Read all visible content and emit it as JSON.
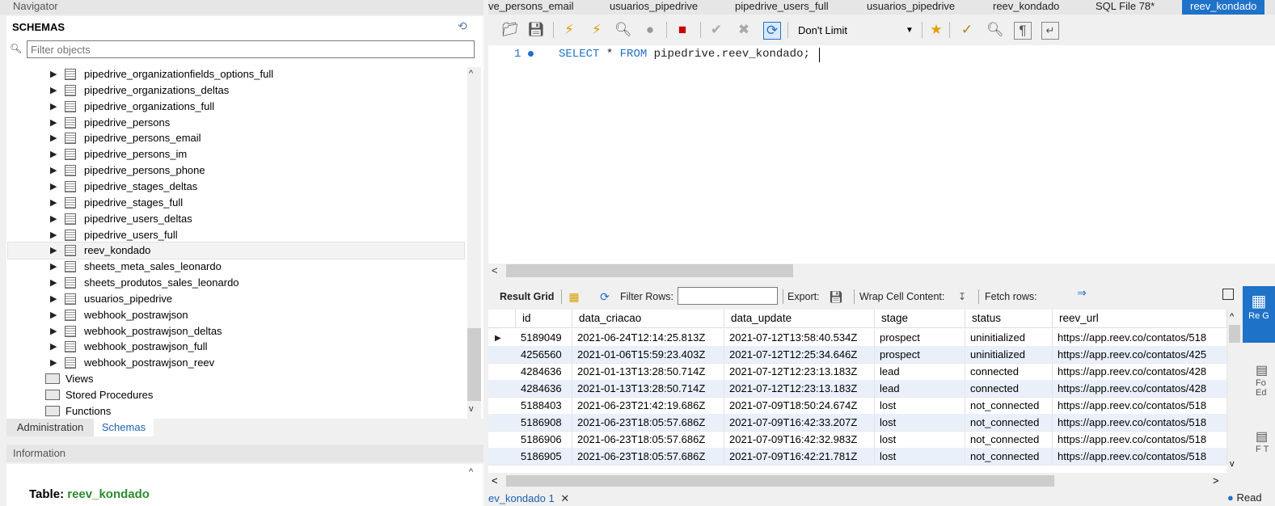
{
  "navigator": {
    "title": "Navigator",
    "schemas_label": "SCHEMAS",
    "filter_placeholder": "Filter objects",
    "tree_items": [
      "pipedrive_organizationfields_options_full",
      "pipedrive_organizations_deltas",
      "pipedrive_organizations_full",
      "pipedrive_persons",
      "pipedrive_persons_email",
      "pipedrive_persons_im",
      "pipedrive_persons_phone",
      "pipedrive_stages_deltas",
      "pipedrive_stages_full",
      "pipedrive_users_deltas",
      "pipedrive_users_full",
      "reev_kondado",
      "sheets_meta_sales_leonardo",
      "sheets_produtos_sales_leonardo",
      "usuarios_pipedrive",
      "webhook_postrawjson",
      "webhook_postrawjson_deltas",
      "webhook_postrawjson_full",
      "webhook_postrawjson_reev"
    ],
    "selected_item": "reev_kondado",
    "folders": [
      "Views",
      "Stored Procedures",
      "Functions"
    ]
  },
  "bottom_tabs": {
    "administration": "Administration",
    "schemas": "Schemas"
  },
  "information": {
    "title": "Information",
    "table_prefix": "Table:",
    "table_name": "reev_kondado"
  },
  "editor_tabs": [
    "ve_persons_email",
    "usuarios_pipedrive",
    "pipedrive_users_full",
    "usuarios_pipedrive",
    "reev_kondado",
    "SQL File 78*",
    "reev_kondado"
  ],
  "active_editor_tab": 6,
  "toolbar": {
    "limit_value": "Don't Limit"
  },
  "sql": {
    "line_number": "1",
    "kw_select": "SELECT",
    "star": " * ",
    "kw_from": "FROM",
    "rest": " pipedrive.reev_kondado;"
  },
  "result_toolbar": {
    "result_grid": "Result Grid",
    "filter_rows": "Filter Rows:",
    "export": "Export:",
    "wrap_cell": "Wrap Cell Content:",
    "fetch_rows": "Fetch rows:"
  },
  "grid": {
    "columns": [
      "id",
      "data_criacao",
      "data_update",
      "stage",
      "status",
      "reev_url"
    ],
    "rows": [
      [
        "5189049",
        "2021-06-24T12:14:25.813Z",
        "2021-07-12T13:58:40.534Z",
        "prospect",
        "uninitialized",
        "https://app.reev.co/contatos/518"
      ],
      [
        "4256560",
        "2021-01-06T15:59:23.403Z",
        "2021-07-12T12:25:34.646Z",
        "prospect",
        "uninitialized",
        "https://app.reev.co/contatos/425"
      ],
      [
        "4284636",
        "2021-01-13T13:28:50.714Z",
        "2021-07-12T12:23:13.183Z",
        "lead",
        "connected",
        "https://app.reev.co/contatos/428"
      ],
      [
        "4284636",
        "2021-01-13T13:28:50.714Z",
        "2021-07-12T12:23:13.183Z",
        "lead",
        "connected",
        "https://app.reev.co/contatos/428"
      ],
      [
        "5188403",
        "2021-06-23T21:42:19.686Z",
        "2021-07-09T18:50:24.674Z",
        "lost",
        "not_connected",
        "https://app.reev.co/contatos/518"
      ],
      [
        "5186908",
        "2021-06-23T18:05:57.686Z",
        "2021-07-09T16:42:33.207Z",
        "lost",
        "not_connected",
        "https://app.reev.co/contatos/518"
      ],
      [
        "5186906",
        "2021-06-23T18:05:57.686Z",
        "2021-07-09T16:42:32.983Z",
        "lost",
        "not_connected",
        "https://app.reev.co/contatos/518"
      ],
      [
        "5186905",
        "2021-06-23T18:05:57.686Z",
        "2021-07-09T16:42:21.781Z",
        "lost",
        "not_connected",
        "https://app.reev.co/contatos/518"
      ]
    ]
  },
  "result_bottom_tab": "ev_kondado 1",
  "side_panel": {
    "result_label": "Re G",
    "form_label": "Fo Ed",
    "field_label": "F T"
  },
  "status_text": "Read"
}
